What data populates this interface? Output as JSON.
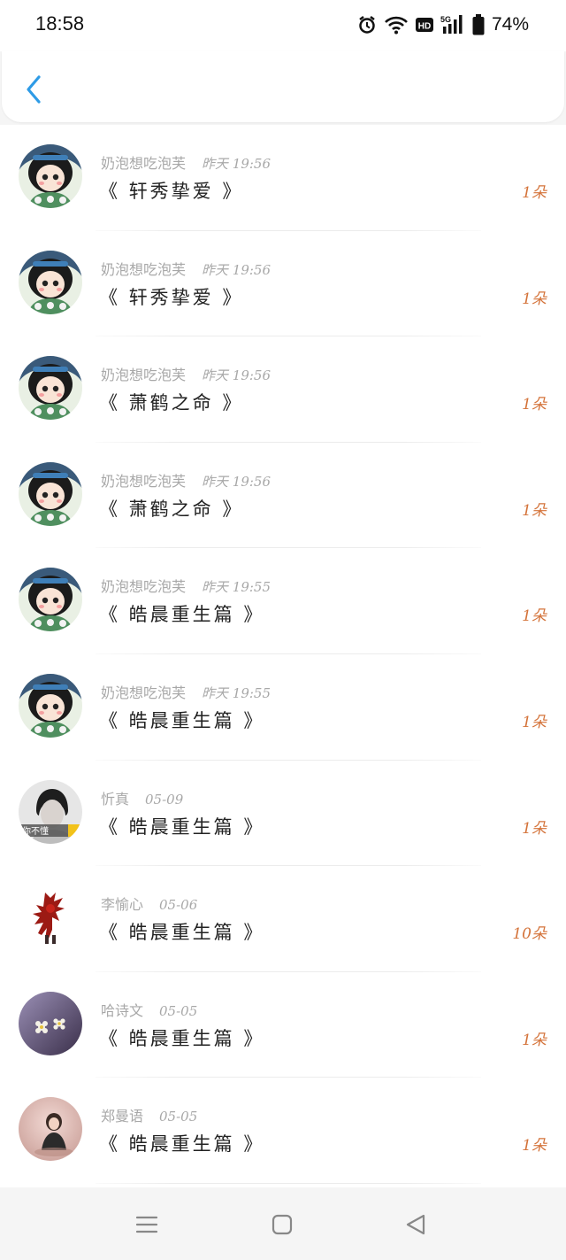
{
  "status_bar": {
    "time": "18:58",
    "battery_percent": "74%",
    "icons": [
      "alarm-icon",
      "wifi-icon",
      "hd-icon",
      "5g-signal-icon",
      "battery-icon"
    ]
  },
  "header": {
    "back_icon": "chevron-left-icon",
    "accent_color": "#2e9be6"
  },
  "items": [
    {
      "user": "奶泡想吃泡芙",
      "date": "昨天 19:56",
      "title": "《 轩秀挚爱 》",
      "count": "1朵",
      "avatar": "cartoon-girl-avatar"
    },
    {
      "user": "奶泡想吃泡芙",
      "date": "昨天 19:56",
      "title": "《 轩秀挚爱 》",
      "count": "1朵",
      "avatar": "cartoon-girl-avatar"
    },
    {
      "user": "奶泡想吃泡芙",
      "date": "昨天 19:56",
      "title": "《 萧鹤之命 》",
      "count": "1朵",
      "avatar": "cartoon-girl-avatar"
    },
    {
      "user": "奶泡想吃泡芙",
      "date": "昨天 19:56",
      "title": "《 萧鹤之命 》",
      "count": "1朵",
      "avatar": "cartoon-girl-avatar"
    },
    {
      "user": "奶泡想吃泡芙",
      "date": "昨天 19:55",
      "title": "《 皓晨重生篇 》",
      "count": "1朵",
      "avatar": "cartoon-girl-avatar"
    },
    {
      "user": "奶泡想吃泡芙",
      "date": "昨天 19:55",
      "title": "《 皓晨重生篇 》",
      "count": "1朵",
      "avatar": "cartoon-girl-avatar"
    },
    {
      "user": "忻真",
      "date": "05-09",
      "title": "《 皓晨重生篇 》",
      "count": "1朵",
      "avatar": "boy-photo-avatar",
      "avatar_text": "你不懂"
    },
    {
      "user": "李愉心",
      "date": "05-06",
      "title": "《 皓晨重生篇 》",
      "count": "10朵",
      "avatar": "red-robot-avatar"
    },
    {
      "user": "哈诗文",
      "date": "05-05",
      "title": "《 皓晨重生篇 》",
      "count": "1朵",
      "avatar": "flowers-avatar"
    },
    {
      "user": "郑曼语",
      "date": "05-05",
      "title": "《 皓晨重生篇 》",
      "count": "1朵",
      "avatar": "girl-photo-avatar"
    }
  ],
  "nav_bar": {
    "icons": [
      "menu-icon",
      "home-icon",
      "back-triangle-icon"
    ]
  },
  "colors": {
    "count": "#d4733a",
    "meta": "#a8a8a8",
    "title": "#222222"
  }
}
